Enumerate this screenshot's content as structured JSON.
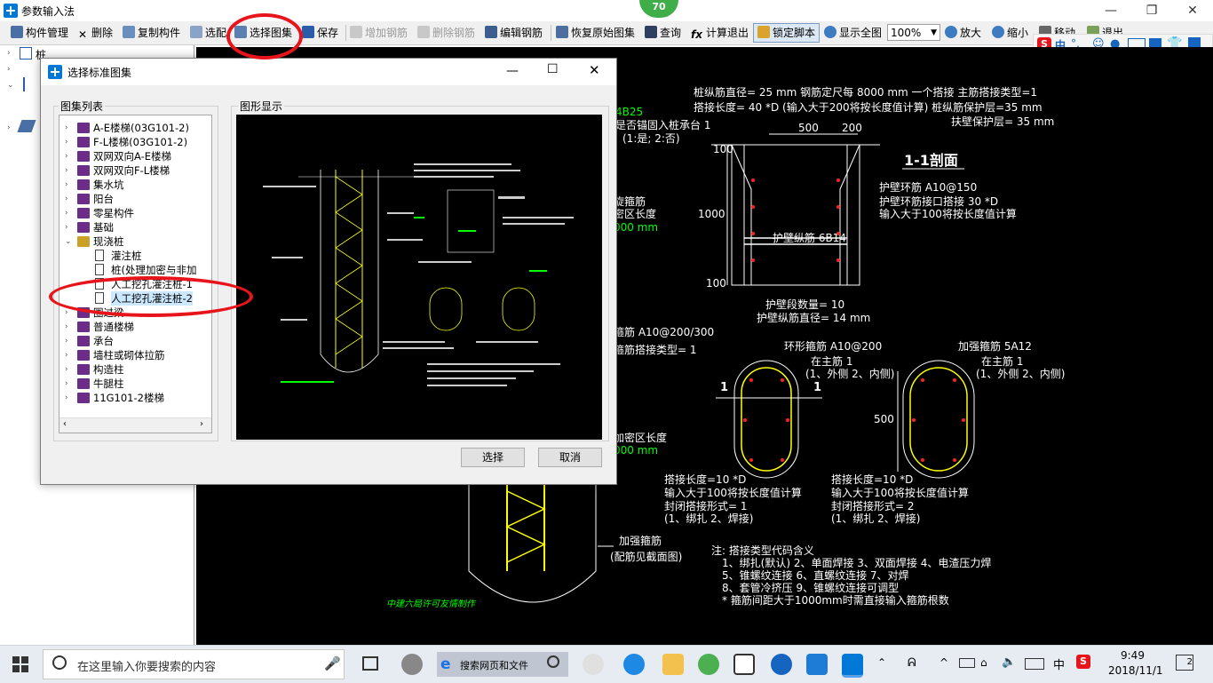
{
  "app": {
    "title": "参数输入法",
    "badge": "70"
  },
  "toolbar": {
    "items": [
      {
        "label": "构件管理"
      },
      {
        "label": "删除"
      },
      {
        "label": "复制构件"
      },
      {
        "label": "选配"
      },
      {
        "label": "选择图集"
      },
      {
        "label": "保存"
      },
      {
        "label": "增加钢筋"
      },
      {
        "label": "删除钢筋"
      },
      {
        "label": "编辑钢筋"
      },
      {
        "label": "恢复原始图集"
      },
      {
        "label": "查询"
      },
      {
        "label": "计算退出"
      },
      {
        "label": "锁定脚本"
      },
      {
        "label": "显示全图"
      },
      {
        "label": "放大"
      },
      {
        "label": "缩小"
      },
      {
        "label": "移动"
      },
      {
        "label": "退出"
      }
    ],
    "zoom": "100%"
  },
  "ime": {
    "lang": "中",
    "punct": "°,"
  },
  "left_tree": {
    "top_item": "桩"
  },
  "dialog": {
    "title": "选择标准图集",
    "list_label": "图集列表",
    "preview_label": "图形显示",
    "select_button": "选择",
    "cancel_button": "取消",
    "items": [
      {
        "label": "A-E楼梯(03G101-2)",
        "kind": "book",
        "level": 0
      },
      {
        "label": "F-L楼梯(03G101-2)",
        "kind": "book",
        "level": 0
      },
      {
        "label": "双网双向A-E楼梯",
        "kind": "book",
        "level": 0
      },
      {
        "label": "双网双向F-L楼梯",
        "kind": "book",
        "level": 0
      },
      {
        "label": "集水坑",
        "kind": "book",
        "level": 0
      },
      {
        "label": "阳台",
        "kind": "book",
        "level": 0
      },
      {
        "label": "零星构件",
        "kind": "book",
        "level": 0
      },
      {
        "label": "基础",
        "kind": "book",
        "level": 0
      },
      {
        "label": "现浇桩",
        "kind": "openbook",
        "level": 0
      },
      {
        "label": "灌注桩",
        "kind": "doc",
        "level": 1
      },
      {
        "label": "桩(处理加密与非加",
        "kind": "doc",
        "level": 1
      },
      {
        "label": "人工挖孔灌注桩-1",
        "kind": "doc",
        "level": 1
      },
      {
        "label": "人工挖孔灌注桩-2",
        "kind": "doc",
        "level": 1,
        "selected": true
      },
      {
        "label": "圈过梁",
        "kind": "book",
        "level": 0
      },
      {
        "label": "普通楼梯",
        "kind": "book",
        "level": 0
      },
      {
        "label": "承台",
        "kind": "book",
        "level": 0
      },
      {
        "label": "墙柱或砌体拉筋",
        "kind": "book",
        "level": 0
      },
      {
        "label": "构造柱",
        "kind": "book",
        "level": 0
      },
      {
        "label": "牛腿柱",
        "kind": "book",
        "level": 0
      },
      {
        "label": "11G101-2楼梯",
        "kind": "book",
        "level": 0
      }
    ]
  },
  "drawing": {
    "top1": "桩纵筋直径= 25 mm  钢筋定尺每 8000 mm 一个搭接  主筋搭接类型=1",
    "top2": "搭接长度= 40  *D (输入大于200将按长度值计算)  桩纵筋保护层=35 mm",
    "top3": "扶壁保护层= 35 mm",
    "left1": "4B25",
    "left2": "是否锚固入桩承台 1",
    "left3": "(1:是; 2:否)",
    "left4": "旋箍筋",
    "left5": "密区长度",
    "left6": "000  mm",
    "left7": "箍筋 A10@200/300",
    "left8": "箍筋搭接类型= 1",
    "left9": "加密区长度",
    "left10": "000  mm",
    "section_title": "1-1剖面",
    "dim500": "500",
    "dim200": "200",
    "dim100a": "100",
    "dim1000": "1000",
    "dim100b": "100",
    "wall_ring": "护壁环筋  A10@150",
    "wall_ring_lap": "护壁环筋接口搭接 30  *D",
    "wall_ring_note": "输入大于100将按长度值计算",
    "wall_long": "护壁纵筋 6B14",
    "seg_count": "护壁段数量= 10",
    "wall_diam": "护壁纵筋直径= 14 mm",
    "ring_hoop": "环形箍筋 A10@200",
    "ring_pos": "在主筋 1",
    "ring_pos_opt": "(1、外侧  2、内侧)",
    "strong_hoop": "加强箍筋 5A12",
    "strong_pos": "在主筋 1",
    "strong_pos_opt": "(1、外侧  2、内侧)",
    "cut1": "1",
    "cut2": "1",
    "dim500b": "500",
    "lap1": "搭接长度=10  *D",
    "lap1n": "输入大于100将按长度值计算",
    "lap1c": "封闭搭接形式= 1",
    "lap1o": "(1、绑扎  2、焊接)",
    "lap2": "搭接长度=10  *D",
    "lap2n": "输入大于100将按长度值计算",
    "lap2c": "封闭搭接形式= 2",
    "lap2o": "(1、绑扎  2、焊接)",
    "strong_label": "加强箍筋",
    "strong_note": "(配筋见截面图)",
    "note_title": "注: 搭接类型代码含义",
    "note1": "1、绑扎(默认)   2、单面焊接   3、双面焊接   4、电渣压力焊",
    "note2": "5、锥螺纹连接   6、直螺纹连接   7、对焊",
    "note3": "8、套管冷挤压   9、锥螺纹连接可调型",
    "note4": "* 箍筋间距大于1000mm时需直接输入箍筋根数",
    "credit": "中建六局许可友情制作"
  },
  "taskbar": {
    "search_placeholder": "在这里输入你要搜索的内容",
    "web_search": "搜索网页和文件",
    "time": "9:49",
    "date": "2018/11/1",
    "ime": "中",
    "notif": "2"
  },
  "colors": {
    "accent": "#0078d7",
    "annotation_red": "#e8141b",
    "cad_green": "#00ff00",
    "cad_yellow": "#ffff00",
    "cad_white": "#ffffff"
  }
}
